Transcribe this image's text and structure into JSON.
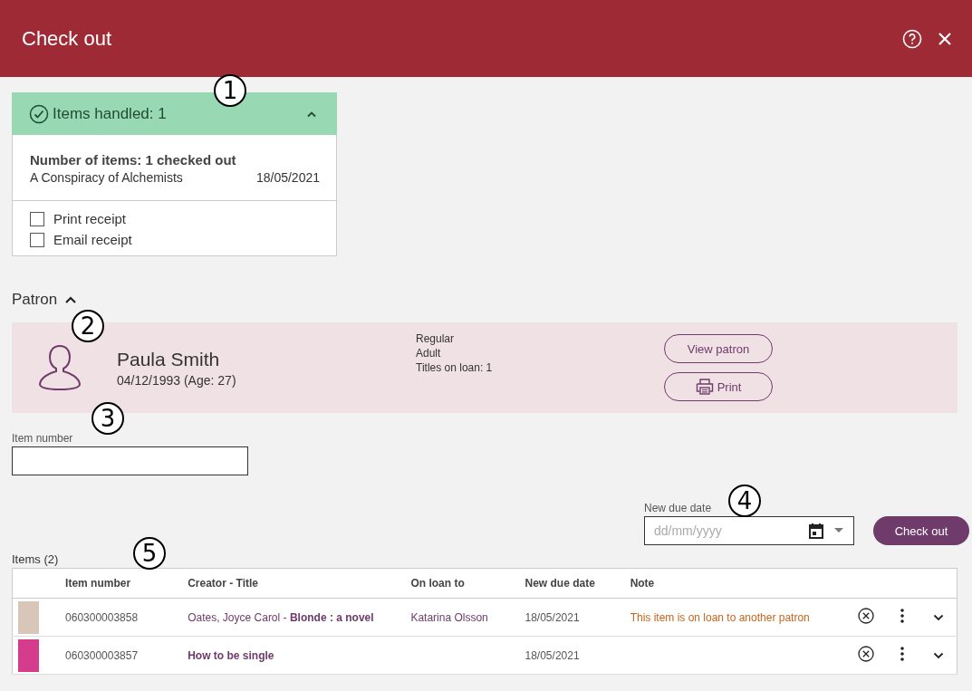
{
  "header": {
    "title": "Check out"
  },
  "handled": {
    "title": "Items handled: 1",
    "expanded": true,
    "summary": "Number of items: 1 checked out",
    "items": [
      {
        "title": "A Conspiracy of Alchemists",
        "date": "18/05/2021"
      }
    ],
    "options": [
      {
        "label": "Print receipt",
        "checked": false
      },
      {
        "label": "Email receipt",
        "checked": false
      }
    ]
  },
  "patron": {
    "heading": "Patron",
    "expanded": true,
    "name": "Paula Smith",
    "birth": "04/12/1993 (Age: 27)",
    "details": [
      "Regular",
      "Adult",
      "Titles on loan: 1"
    ],
    "buttons": [
      {
        "label": "View patron",
        "kind": "text"
      },
      {
        "label": "Print",
        "kind": "print"
      }
    ]
  },
  "item_field": {
    "label": "Item number"
  },
  "due_date": {
    "label": "New due date",
    "placeholder": "dd/mm/yyyy"
  },
  "checkout_button": "Check out",
  "items": {
    "title": "Items (2)",
    "columns": [
      "Item number",
      "Creator - Title",
      "On loan to",
      "New due date",
      "Note"
    ],
    "rows": [
      {
        "item_number": "060300003858",
        "creator_title": "Oates, Joyce Carol - **Blonde : a novel**",
        "on_loan_to": "Katarina Olsson",
        "due": "18/05/2021",
        "note": "This item is on loan to another patron"
      },
      {
        "item_number": "060300003857",
        "creator_title": "**How to be single**",
        "due": "18/05/2021"
      }
    ]
  },
  "callouts": [
    "1",
    "2",
    "3",
    "4",
    "5"
  ]
}
